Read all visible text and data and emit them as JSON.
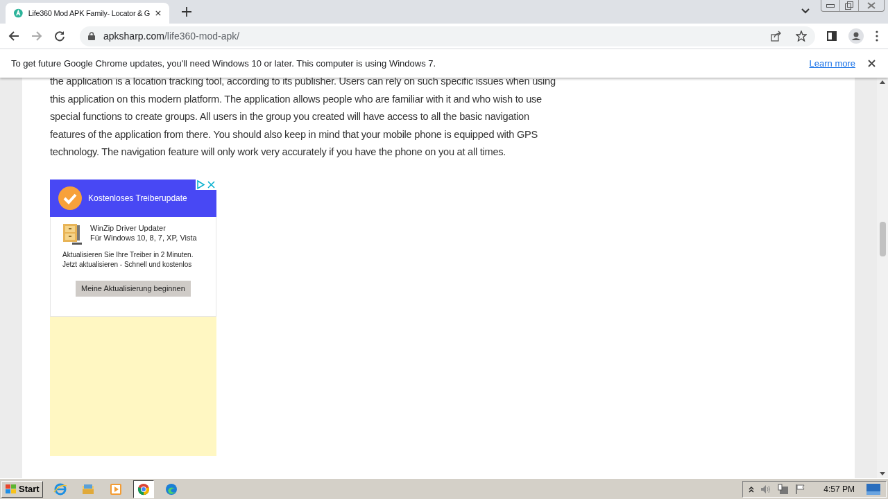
{
  "tab": {
    "title": "Life360 Mod APK Family- Locator & G",
    "selected": true
  },
  "address_bar": {
    "domain": "apksharp.com",
    "path": "/life360-mod-apk/"
  },
  "infobar": {
    "message": "To get future Google Chrome updates, you'll need Windows 10 or later. This computer is using Windows 7.",
    "link": "Learn more"
  },
  "article": {
    "paragraph": "the application is a location tracking tool, according to its publisher. Users can rely on such specific issues when using this application on this modern platform. The application allows people who are familiar with it and who wish to use special functions to create groups. All users in the group you created will have access to all the basic navigation features of the application from there. You should also keep in mind that your mobile phone is equipped with GPS technology. The navigation feature will only work very accurately if you have the phone on you at all times."
  },
  "ad": {
    "headline": "Kostenloses Treiberupdate",
    "product": "WinZip Driver Updater",
    "platforms": "Für Windows 10, 8, 7, XP, Vista",
    "body_lines": [
      "Aktualisieren Sie Ihre Treiber in 2 Minuten.",
      "Jetzt aktualisieren - Schnell und kostenlos"
    ],
    "button": "Meine Aktualisierung beginnen"
  },
  "taskbar": {
    "start": "Start",
    "apps": [
      {
        "kind": "ie",
        "selected": false
      },
      {
        "kind": "explorer",
        "selected": false
      },
      {
        "kind": "media",
        "selected": false
      },
      {
        "kind": "chrome",
        "selected": true
      },
      {
        "kind": "edge",
        "selected": false
      }
    ],
    "clock": "4:57 PM"
  }
}
